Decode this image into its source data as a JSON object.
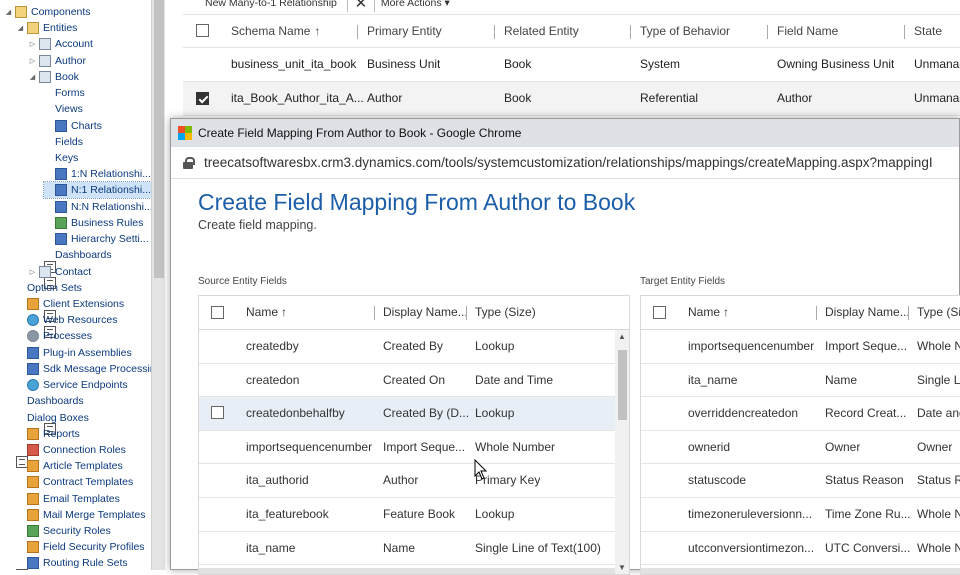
{
  "tree": {
    "items": [
      {
        "label": "Components",
        "icon": "folder-icon",
        "level": 0,
        "expanded": true
      },
      {
        "label": "Entities",
        "icon": "folder-icon",
        "level": 1,
        "expanded": true
      },
      {
        "label": "Account",
        "icon": "entity-icon",
        "level": 2,
        "expanded": false
      },
      {
        "label": "Author",
        "icon": "entity-icon",
        "level": 2,
        "expanded": false
      },
      {
        "label": "Book",
        "icon": "entity-icon",
        "level": 2,
        "expanded": true
      },
      {
        "label": "Forms",
        "icon": "form-icon",
        "level": 3
      },
      {
        "label": "Views",
        "icon": "view-icon",
        "level": 3
      },
      {
        "label": "Charts",
        "icon": "chart-icon",
        "level": 3
      },
      {
        "label": "Fields",
        "icon": "field-icon",
        "level": 3
      },
      {
        "label": "Keys",
        "icon": "key-icon",
        "level": 3
      },
      {
        "label": "1:N Relationshi...",
        "icon": "relationship-icon",
        "level": 3
      },
      {
        "label": "N:1 Relationshi...",
        "icon": "relationship-icon",
        "level": 3,
        "selected": true
      },
      {
        "label": "N:N Relationshi...",
        "icon": "relationship-icon",
        "level": 3
      },
      {
        "label": "Business Rules",
        "icon": "business-rules-icon",
        "level": 3
      },
      {
        "label": "Hierarchy Setti...",
        "icon": "hierarchy-icon",
        "level": 3
      },
      {
        "label": "Dashboards",
        "icon": "dashboard-icon",
        "level": 3
      },
      {
        "label": "Contact",
        "icon": "entity-icon",
        "level": 2,
        "expanded": false
      },
      {
        "label": "Option Sets",
        "icon": "option-set-icon",
        "level": 1
      },
      {
        "label": "Client Extensions",
        "icon": "client-extensions-icon",
        "level": 1
      },
      {
        "label": "Web Resources",
        "icon": "web-resources-icon",
        "level": 1
      },
      {
        "label": "Processes",
        "icon": "processes-icon",
        "level": 1
      },
      {
        "label": "Plug-in Assemblies",
        "icon": "plugin-icon",
        "level": 1
      },
      {
        "label": "Sdk Message Processin...",
        "icon": "sdk-message-icon",
        "level": 1
      },
      {
        "label": "Service Endpoints",
        "icon": "service-endpoint-icon",
        "level": 1
      },
      {
        "label": "Dashboards",
        "icon": "dashboard-icon",
        "level": 1
      },
      {
        "label": "Dialog Boxes",
        "icon": "dialog-icon",
        "level": 1
      },
      {
        "label": "Reports",
        "icon": "reports-icon",
        "level": 1
      },
      {
        "label": "Connection Roles",
        "icon": "connection-roles-icon",
        "level": 1
      },
      {
        "label": "Article Templates",
        "icon": "template-icon",
        "level": 1
      },
      {
        "label": "Contract Templates",
        "icon": "template-icon",
        "level": 1
      },
      {
        "label": "Email Templates",
        "icon": "template-icon",
        "level": 1
      },
      {
        "label": "Mail Merge Templates",
        "icon": "template-icon",
        "level": 1
      },
      {
        "label": "Security Roles",
        "icon": "security-roles-icon",
        "level": 1
      },
      {
        "label": "Field Security Profiles",
        "icon": "field-security-icon",
        "level": 1
      },
      {
        "label": "Routing Rule Sets",
        "icon": "routing-icon",
        "level": 1
      }
    ]
  },
  "toolbar": {
    "new_relationship": "New Many-to-1 Relationship",
    "more_actions": "More Actions"
  },
  "bg_table": {
    "headers": [
      "Schema Name",
      "Primary Entity",
      "Related Entity",
      "Type of Behavior",
      "Field Name",
      "State"
    ],
    "rows": [
      {
        "checked": false,
        "cells": [
          "business_unit_ita_book",
          "Business Unit",
          "Book",
          "System",
          "Owning Business Unit",
          "Unmanag"
        ]
      },
      {
        "checked": true,
        "cells": [
          "ita_Book_Author_ita_A...",
          "Author",
          "Book",
          "Referential",
          "Author",
          "Unmanag"
        ]
      }
    ]
  },
  "window": {
    "title": "Create Field Mapping From Author to Book - Google Chrome",
    "url": "treecatsoftwaresbx.crm3.dynamics.com/tools/systemcustomization/relationships/mappings/createMapping.aspx?mappingI",
    "logo_colors": [
      "#f25022",
      "#7fba00",
      "#00a4ef",
      "#ffb900"
    ]
  },
  "page": {
    "title": "Create Field Mapping From Author to Book",
    "subtitle": "Create field mapping."
  },
  "source": {
    "label": "Source Entity Fields",
    "headers": [
      "Name",
      "Display Name...",
      "Type (Size)"
    ],
    "rows": [
      [
        "createdby",
        "Created By",
        "Lookup"
      ],
      [
        "createdon",
        "Created On",
        "Date and Time"
      ],
      [
        "createdonbehalfby",
        "Created By (D...",
        "Lookup"
      ],
      [
        "importsequencenumber",
        "Import Seque...",
        "Whole Number"
      ],
      [
        "ita_authorid",
        "Author",
        "Primary Key"
      ],
      [
        "ita_featurebook",
        "Feature Book",
        "Lookup"
      ],
      [
        "ita_name",
        "Name",
        "Single Line of Text(100)"
      ]
    ]
  },
  "target": {
    "label": "Target Entity Fields",
    "headers": [
      "Name",
      "Display Name...",
      "Type (Si"
    ],
    "rows": [
      [
        "importsequencenumber",
        "Import Seque...",
        "Whole N"
      ],
      [
        "ita_name",
        "Name",
        "Single Li"
      ],
      [
        "overriddencreatedon",
        "Record Creat...",
        "Date and"
      ],
      [
        "ownerid",
        "Owner",
        "Owner"
      ],
      [
        "statuscode",
        "Status Reason",
        "Status R"
      ],
      [
        "timezoneruleversionn...",
        "Time Zone Ru...",
        "Whole N"
      ],
      [
        "utcconversiontimezon...",
        "UTC Conversi...",
        "Whole N"
      ]
    ]
  },
  "sort_arrow": "↑",
  "dropdown_arrow": "▾",
  "close_glyph": "✕",
  "accent_color": "#1d5ea8"
}
